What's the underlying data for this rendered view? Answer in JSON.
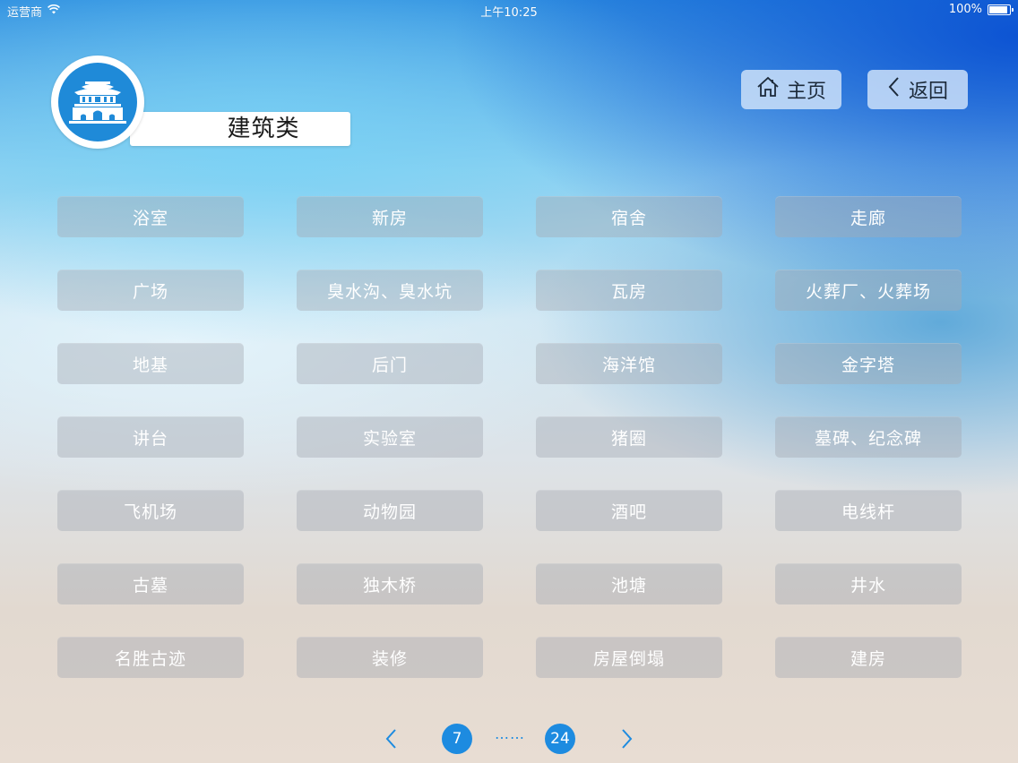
{
  "status_bar": {
    "carrier": "运营商",
    "time": "上午10:25",
    "battery": "100%",
    "battery_level": 1.0
  },
  "category": {
    "title": "建筑类",
    "icon": "palace-icon"
  },
  "nav": {
    "home_label": "主页",
    "back_label": "返回"
  },
  "grid": {
    "items": [
      "浴室",
      "新房",
      "宿舍",
      "走廊",
      "广场",
      "臭水沟、臭水坑",
      "瓦房",
      "火葬厂、火葬场",
      "地基",
      "后门",
      "海洋馆",
      "金字塔",
      "讲台",
      "实验室",
      "猪圈",
      "墓碑、纪念碑",
      "飞机场",
      "动物园",
      "酒吧",
      "电线杆",
      "古墓",
      "独木桥",
      "池塘",
      "井水",
      "名胜古迹",
      "装修",
      "房屋倒塌",
      "建房"
    ]
  },
  "pagination": {
    "current": "7",
    "separator": "……",
    "total": "24"
  },
  "colors": {
    "accent": "#1d8be0",
    "logo_bg": "#1f8ad8"
  }
}
